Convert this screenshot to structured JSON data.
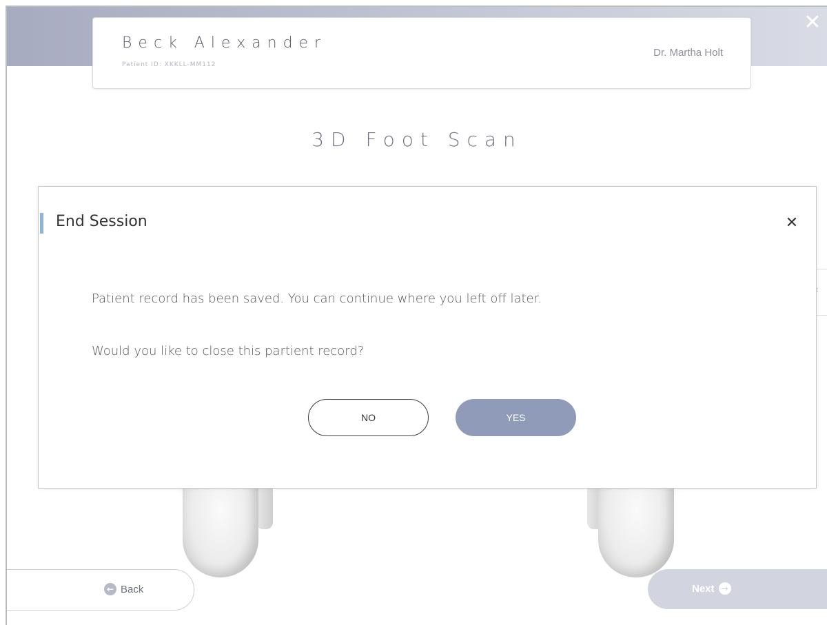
{
  "header": {
    "patient_name": "Beck Alexander",
    "patient_id": "Patient ID: XKKLL-MM112",
    "doctor_name": "Dr. Martha Holt"
  },
  "page": {
    "title": "3D Foot Scan"
  },
  "navigation": {
    "back_label": "Back",
    "next_label": "Next"
  },
  "dialog": {
    "title": "End Session",
    "message_saved": "Patient record has been saved. You can continue where you left off later.",
    "message_question": "Would you like to close this partient record?",
    "no_label": "NO",
    "yes_label": "YES"
  },
  "colors": {
    "header_band": "#a7abc0",
    "accent_bar": "#8eb4d9",
    "yes_button": "#8f9bb8",
    "next_button": "#d2d5df"
  },
  "icons": {
    "window_close": "close-icon",
    "dialog_close": "close-icon",
    "back": "arrow-left-circle-icon",
    "next": "arrow-right-circle-icon"
  }
}
